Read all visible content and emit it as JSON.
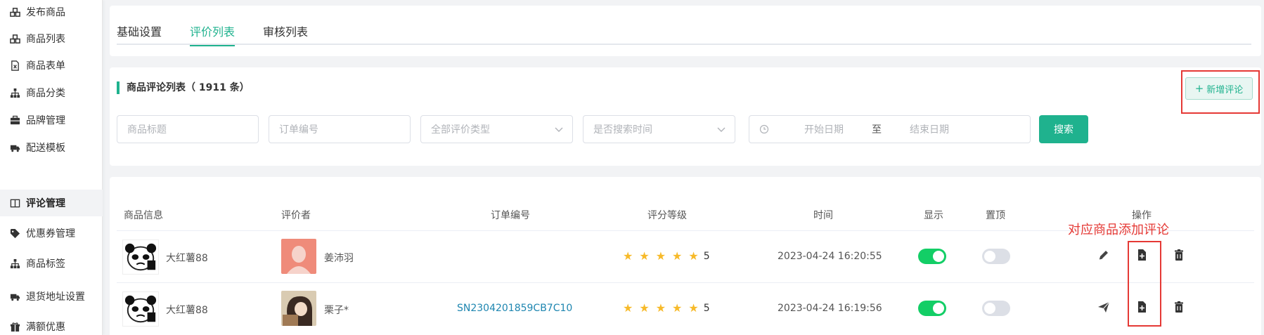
{
  "sidebar": {
    "items": [
      {
        "label": "发布商品",
        "icon": "cubes-icon"
      },
      {
        "label": "商品列表",
        "icon": "cubes-icon"
      },
      {
        "label": "商品表单",
        "icon": "excel-file-icon"
      },
      {
        "label": "商品分类",
        "icon": "sitemap-icon"
      },
      {
        "label": "品牌管理",
        "icon": "briefcase-icon"
      },
      {
        "label": "配送模板",
        "icon": "truck-icon"
      },
      {
        "label": "评论管理",
        "icon": "columns-icon"
      },
      {
        "label": "优惠券管理",
        "icon": "tag-icon"
      },
      {
        "label": "商品标签",
        "icon": "sitemap-icon"
      },
      {
        "label": "退货地址设置",
        "icon": "truck-icon"
      },
      {
        "label": "满额优惠",
        "icon": "gift-icon"
      }
    ],
    "active_index": 6
  },
  "tabs": {
    "items": [
      "基础设置",
      "评价列表",
      "审核列表"
    ],
    "active_index": 1
  },
  "filter": {
    "title": "商品评论列表（ 1911 条）",
    "add_button": "新增评论",
    "product_title_placeholder": "商品标题",
    "order_no_placeholder": "订单编号",
    "review_type_placeholder": "全部评价类型",
    "search_time_placeholder": "是否搜索时间",
    "start_date_placeholder": "开始日期",
    "range_separator": "至",
    "end_date_placeholder": "结束日期",
    "search_button": "搜索"
  },
  "table": {
    "columns": [
      "商品信息",
      "评价者",
      "订单编号",
      "评分等级",
      "时间",
      "显示",
      "置顶",
      "操作"
    ],
    "rows": [
      {
        "product": "大红薯88",
        "reviewer": "姜沛羽",
        "order_no": "",
        "rating": 5,
        "rating_text": "5",
        "time": "2023-04-24 16:20:55",
        "show": true,
        "pinned": false,
        "first_action": "pencil-icon"
      },
      {
        "product": "大红薯88",
        "reviewer": "栗子*",
        "order_no": "SN2304201859CB7C10",
        "rating": 5,
        "rating_text": "5",
        "time": "2023-04-24 16:19:56",
        "show": true,
        "pinned": false,
        "first_action": "paper-plane-icon"
      }
    ]
  },
  "annotation": "对应商品添加评论",
  "colors": {
    "accent": "#1fb28e",
    "annotation_red": "#e53935",
    "star": "#f7ba2a",
    "switch_on": "#13ce66",
    "link": "#1e86b0"
  }
}
